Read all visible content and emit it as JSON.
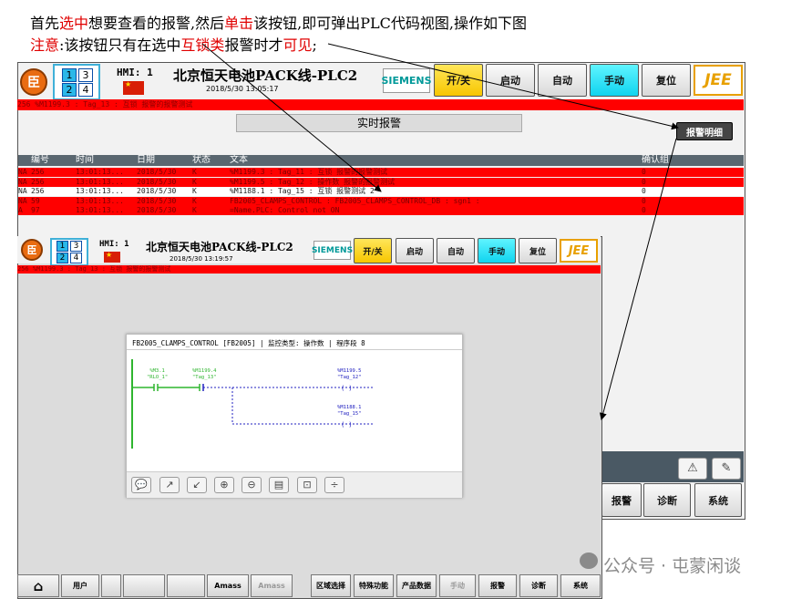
{
  "instructions": {
    "line1": [
      {
        "text": "首先",
        "red": false
      },
      {
        "text": "选中",
        "red": true
      },
      {
        "text": "想要查看的报警,然后",
        "red": false
      },
      {
        "text": "单击",
        "red": true
      },
      {
        "text": "该按钮,即可弹出PLC代码视图,操作如下图",
        "red": false
      }
    ],
    "line2": [
      {
        "text": "注意",
        "red": true
      },
      {
        "text": ":该按钮只有在选中",
        "red": false
      },
      {
        "text": "互锁类",
        "red": true
      },
      {
        "text": "报警时才",
        "red": false
      },
      {
        "text": "可见",
        "red": true
      },
      {
        "text": ";",
        "red": false
      }
    ]
  },
  "hmi_top": {
    "logo": "臣",
    "screen_numbers": [
      "1",
      "3",
      "2",
      "4"
    ],
    "hmi_label": "HMI: 1",
    "title": "北京恒天电池PACK线-PLC2",
    "datetime": "2018/5/30 13:05:17",
    "siemens": "SIEMENS",
    "buttons": {
      "onoff": "开/关",
      "start": "启动",
      "auto": "自动",
      "manual": "手动",
      "reset": "复位"
    },
    "jee": "JEE",
    "marquee": "256   %M1199.3 : Tag_13 :     互锁    报警的报警测试",
    "realtime_title": "实时报警",
    "alarm_detail_button": "报警明细",
    "columns": [
      "编号",
      "时间",
      "日期",
      "状态",
      "文本",
      "确认组"
    ],
    "rows": [
      {
        "prefix": "NA",
        "num": "256",
        "time": "13:01:13...",
        "date": "2018/5/30",
        "state": "K",
        "text": "%M1199.3 : Tag_11 :     互锁    报警的报警测试",
        "group": "0",
        "style": "red"
      },
      {
        "prefix": "NA",
        "num": "256",
        "time": "13:01:13...",
        "date": "2018/5/30",
        "state": "K",
        "text": "%M1199.5 : Tag_12 :     操作数  报警的报警测试",
        "group": "0",
        "style": "red"
      },
      {
        "prefix": "NA",
        "num": "256",
        "time": "13:01:13...",
        "date": "2018/5/30",
        "state": "K",
        "text": "%M1188.1 : Tag_15 : 互锁    报警测试 2",
        "group": "0",
        "style": "white"
      },
      {
        "prefix": "NA",
        "num": "59",
        "time": "13:01:13...",
        "date": "2018/5/30",
        "state": "K",
        "text": "FB2005_CLAMPS_CONTROL : FB2005_CLAMPS_CONTROL_DB : sgn1 :",
        "group": "0",
        "style": "red"
      },
      {
        "prefix": "A",
        "num": "97",
        "time": "13:01:13...",
        "date": "2018/5/30",
        "state": "K",
        "text": "=Name.PLC: Control not ON",
        "group": "0",
        "style": "red"
      }
    ],
    "nav_buttons": {
      "alarm": "报警",
      "diag": "诊断",
      "system": "系统"
    }
  },
  "hmi_bottom": {
    "hmi_label": "HMI: 1",
    "title": "北京恒天电池PACK线-PLC2",
    "datetime": "2018/5/30 13:19:57",
    "marquee": "256   %M1199.3 : Tag_13 :     互锁    报警的报警测试",
    "code_view": {
      "header": "FB2005_CLAMPS_CONTROL [FB2005] | 监控类型: 操作数 | 程序段 8",
      "contacts": [
        {
          "addr": "%M3.1",
          "tag": "\"RLO_1\""
        },
        {
          "addr": "%M1199.4",
          "tag": "\"Tag_13\""
        }
      ],
      "coils": [
        {
          "addr": "%M1199.5",
          "tag": "\"Tag_12\""
        },
        {
          "addr": "%M1188.1",
          "tag": "\"Tag_15\""
        }
      ],
      "toolbar_icons": [
        "comment-icon",
        "forward-icon",
        "back-icon",
        "zoom-in-icon",
        "zoom-out-icon",
        "print-icon",
        "zoom-fit-icon",
        "formula-icon"
      ]
    },
    "bottom_buttons": [
      "用户",
      "",
      "",
      "",
      "Amass",
      "区域选择",
      "特殊功能",
      "产品数据",
      "手动",
      "报警",
      "诊断",
      "系统"
    ]
  },
  "watermark": "公众号 · 屯蒙闲谈"
}
